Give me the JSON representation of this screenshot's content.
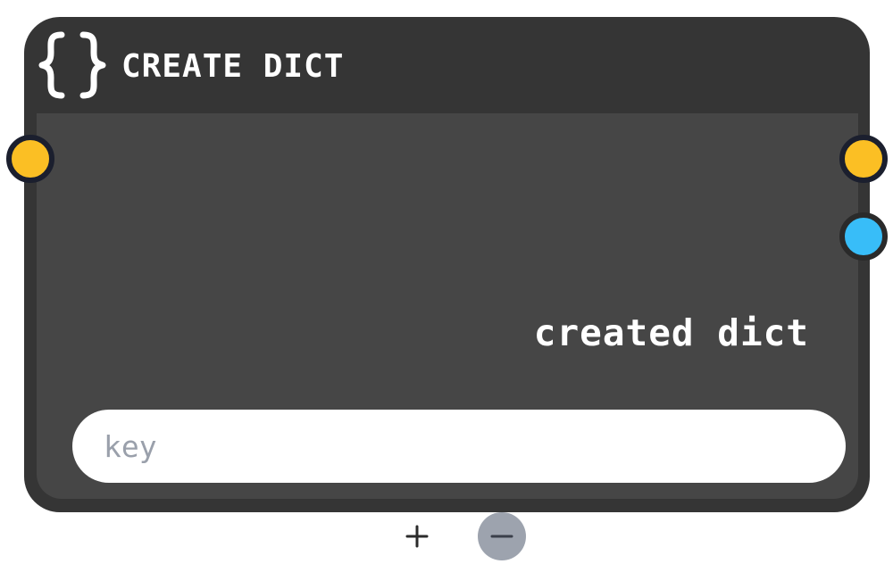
{
  "node": {
    "title": "CREATE DICT",
    "header_icon": "curly-braces-icon",
    "output_label": "created dict",
    "key_input": {
      "value": "",
      "placeholder": "key"
    },
    "buttons": {
      "add_icon": "plus-icon",
      "remove_icon": "minus-icon"
    }
  },
  "colors": {
    "node_frame": "#353535",
    "node_body": "#464646",
    "exec_port": "#fbbf24",
    "data_port": "#38bdf8",
    "port_border": "#1b1f2e",
    "remove_button": "#9da3ae"
  }
}
